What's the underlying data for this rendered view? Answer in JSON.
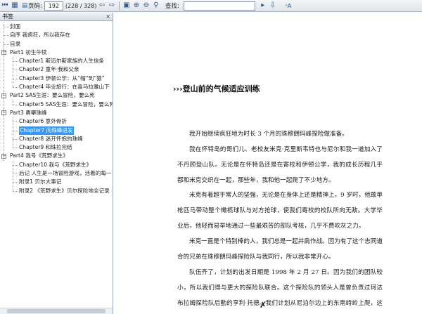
{
  "toolbar": {
    "page_label": "页码:",
    "page_value": "192",
    "page_total": "(228 / 328)",
    "search_label": "查找:",
    "search_value": "",
    "icons": [
      "first-page-icon",
      "prev-page-icon",
      "bookmark-icon",
      "page-icon",
      "next-page-icon",
      "last-page-icon",
      "back-icon",
      "forward-icon",
      "save-icon",
      "zoom-in-icon",
      "zoom-out-icon",
      "find-icon",
      "find-next-icon",
      "font-icon"
    ]
  },
  "sidebar": {
    "title": "书签",
    "close": "×",
    "items": [
      {
        "label": "封面"
      },
      {
        "label": "自序 我疯狂，所以我存在"
      },
      {
        "label": "目录"
      },
      {
        "label": "Part1 初生牛犊"
      },
      {
        "label": "Chapter1 斯迈尔斯家族的人生信条"
      },
      {
        "label": "Chapter2 童年·我和父亲"
      },
      {
        "label": "Chapter3 伊顿公学：从“帽”到“猿”"
      },
      {
        "label": "Chapter4 毕业旅行：在喜马拉雅山下"
      },
      {
        "label": "Part2 SAS生涯：要么冒险，要么死"
      },
      {
        "label": "Chapter5 SAS生涯：要么冒险，要么死"
      },
      {
        "label": "Part3 勇攀珠峰"
      },
      {
        "label": "Chapter6 意外骨折"
      },
      {
        "label": "Chapter7 向珠峰进发"
      },
      {
        "label": "Chapter8 迷开怀抱的珠峰"
      },
      {
        "label": "Chapter9 和珠拉完结"
      },
      {
        "label": "Part4 我号《荒野求生》"
      },
      {
        "label": "Chapter10 我与《荒野求生》"
      },
      {
        "label": "后记 人生是一场冒险游戏，活着的每一"
      },
      {
        "label": "附录1 贝尔大事记"
      },
      {
        "label": "附录2 《荒野求生》贝尔探险地全记录"
      }
    ]
  },
  "document": {
    "heading": "›››登山前的气候适应训练",
    "paragraphs": [
      "我开始继续疯狂地为时长 3 个月的珠穆朗玛峰探险做准备。",
      "我在怀特岛的哥们儿、老校友米克·克里斯韦特也与尼尔和我一道加入了不丹顾登山队。无论是在怀特岛还是在寄校和伊顿公学，我的成长历程几乎都和米克交织在一起，那些年，我和他一起爬了不少地方。",
      "米克有着超乎常人的坚强，无论是在身体上还是精神上。9 岁时，他敢单枪匹马带动整个橄榄球队与对方抢球，使我们寄校的校队所向无敌。大学毕业后，他轻而易举地通过一些最艰苦的部队考核，几乎不费吹灰之力。",
      "米克一直是个特别棒的人，我们总是一起并肩作战。因为有了这个志同道合的兄弟在珠穆朗玛峰探险队与我同行，所以我非常开心。",
      "队伍齐了，计划的出发日期是 1998 年 2 月 27 日。因为我们的团队较小，所以我们得与更大的探险队联合。这个探险队的领头人是曾负责过珂达布拉姆探险队后勤的亨利·托德。我们计划从尼泊尔边上的东南峙岭上爬，这儿是"
    ]
  }
}
